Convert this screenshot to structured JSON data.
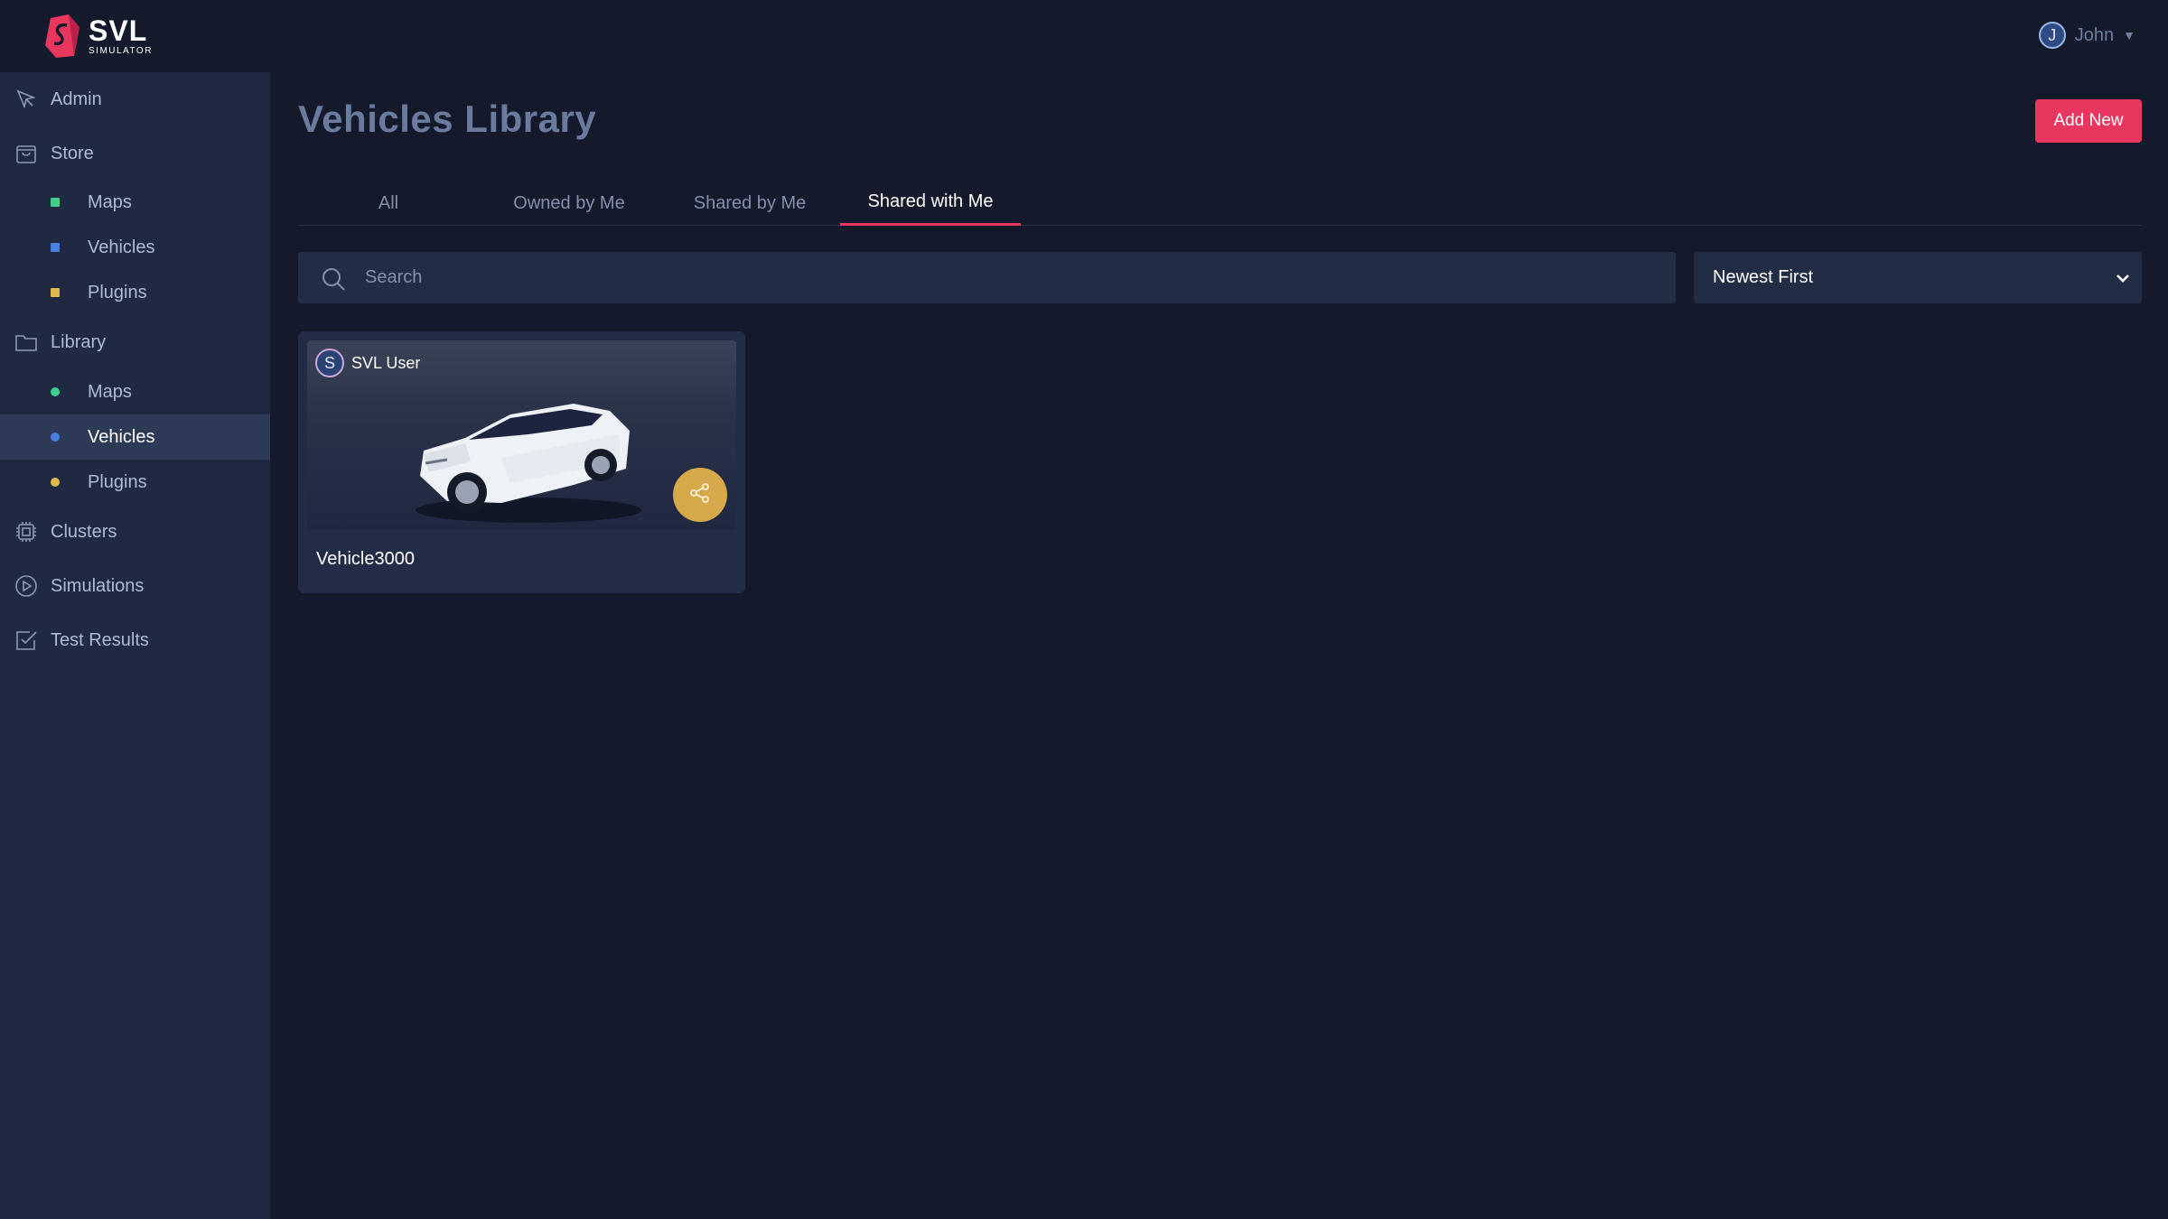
{
  "brand": {
    "name": "SVL",
    "subtitle": "SIMULATOR"
  },
  "user": {
    "initial": "J",
    "name": "John"
  },
  "sidebar": {
    "items": [
      {
        "label": "Admin",
        "icon": "cursor-icon"
      },
      {
        "label": "Store",
        "icon": "shopping-bag-icon"
      },
      {
        "label": "Library",
        "icon": "folder-icon"
      },
      {
        "label": "Clusters",
        "icon": "chip-icon"
      },
      {
        "label": "Simulations",
        "icon": "play-circle-icon"
      },
      {
        "label": "Test Results",
        "icon": "check-square-icon"
      }
    ],
    "store_children": [
      {
        "label": "Maps",
        "color": "#3ecf8e"
      },
      {
        "label": "Vehicles",
        "color": "#4a7fe0"
      },
      {
        "label": "Plugins",
        "color": "#e0b84a"
      }
    ],
    "library_children": [
      {
        "label": "Maps",
        "color": "#3ecf8e"
      },
      {
        "label": "Vehicles",
        "color": "#4a7fe0",
        "active": true
      },
      {
        "label": "Plugins",
        "color": "#e0b84a"
      }
    ]
  },
  "page": {
    "title": "Vehicles Library",
    "add_button": "Add New",
    "tabs": [
      {
        "label": "All"
      },
      {
        "label": "Owned by Me"
      },
      {
        "label": "Shared by Me"
      },
      {
        "label": "Shared with Me",
        "active": true
      }
    ],
    "search": {
      "placeholder": "Search",
      "value": ""
    },
    "sort": {
      "selected": "Newest First"
    }
  },
  "vehicles": [
    {
      "name": "Vehicle3000",
      "owner": "SVL User",
      "owner_initial": "S",
      "action_icon": "share-icon"
    }
  ],
  "colors": {
    "accent": "#e8375f",
    "share": "#d6a94a"
  }
}
